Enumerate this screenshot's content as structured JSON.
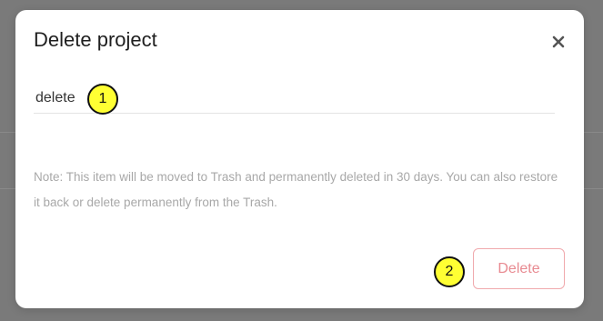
{
  "modal": {
    "title": "Delete project",
    "close_icon": "close-icon",
    "input": {
      "value": "delete",
      "placeholder": ""
    },
    "note": "Note: This item will be moved to Trash and permanently deleted in 30 days. You can also restore it back or delete permanently from the Trash.",
    "delete_label": "Delete"
  },
  "markers": {
    "marker_1": "1",
    "marker_2": "2"
  },
  "colors": {
    "overlay": "#7a7a7a",
    "modal_bg": "#ffffff",
    "delete_border": "#f0a9ad",
    "delete_text": "#e88a91",
    "note_text": "#a8a8a8",
    "marker_fill": "#ffff33"
  }
}
